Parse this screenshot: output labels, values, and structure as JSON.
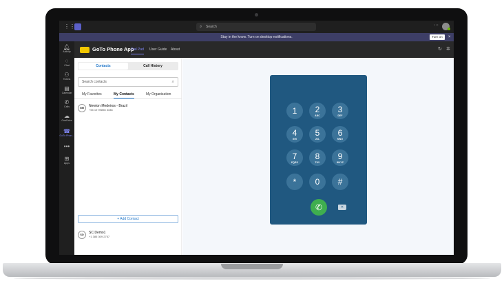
{
  "topbar": {
    "search_placeholder": "Search",
    "more_icon": "more-horizontal-icon",
    "grid_icon": "app-grid-icon"
  },
  "notification": {
    "text": "Stay in the know. Turn on desktop notifications.",
    "button": "Turn on",
    "close": "×"
  },
  "rail": {
    "items": [
      {
        "label": "Activity",
        "icon": "bell-icon"
      },
      {
        "label": "Chat",
        "icon": "chat-icon"
      },
      {
        "label": "Teams",
        "icon": "teams-icon"
      },
      {
        "label": "Calendar",
        "icon": "calendar-icon"
      },
      {
        "label": "Calls",
        "icon": "phone-icon"
      },
      {
        "label": "OneDrive",
        "icon": "cloud-icon"
      },
      {
        "label": "GoTo Phon...",
        "icon": "goto-icon"
      },
      {
        "label": "Apps",
        "icon": "apps-icon"
      }
    ],
    "more": "•••"
  },
  "app_header": {
    "title": "GoTo Phone App",
    "tabs": [
      "Dial Pad",
      "User Guide",
      "About"
    ],
    "active_tab": "Dial Pad"
  },
  "contacts_panel": {
    "segments": [
      "Contacts",
      "Call History"
    ],
    "active_segment": "Contacts",
    "search_placeholder": "Search contacts",
    "subtabs": [
      "My Favorites",
      "My Contacts",
      "My Organization"
    ],
    "active_subtab": "My Contacts",
    "contacts": [
      {
        "initials": "NM",
        "name": "Newton Medeiros - Brazil",
        "phone": "+55 19 99898 3338"
      }
    ],
    "add_contact": "+ Add Contact",
    "current_user": {
      "initials": "SD",
      "name": "SC Demo1",
      "phone": "+1 385 309 2757"
    }
  },
  "dialpad": {
    "keys": [
      {
        "digit": "1",
        "letters": ""
      },
      {
        "digit": "2",
        "letters": "ABC"
      },
      {
        "digit": "3",
        "letters": "DEF"
      },
      {
        "digit": "4",
        "letters": "GHI"
      },
      {
        "digit": "5",
        "letters": "JKL"
      },
      {
        "digit": "6",
        "letters": "MNO"
      },
      {
        "digit": "7",
        "letters": "PQRS"
      },
      {
        "digit": "8",
        "letters": "TUV"
      },
      {
        "digit": "9",
        "letters": "WXYZ"
      },
      {
        "digit": "*",
        "letters": ""
      },
      {
        "digit": "0",
        "letters": ""
      },
      {
        "digit": "#",
        "letters": ""
      }
    ],
    "call_icon": "phone-call-icon",
    "backspace_icon": "backspace-icon",
    "color": "#205880",
    "call_color": "#3fae4f"
  }
}
